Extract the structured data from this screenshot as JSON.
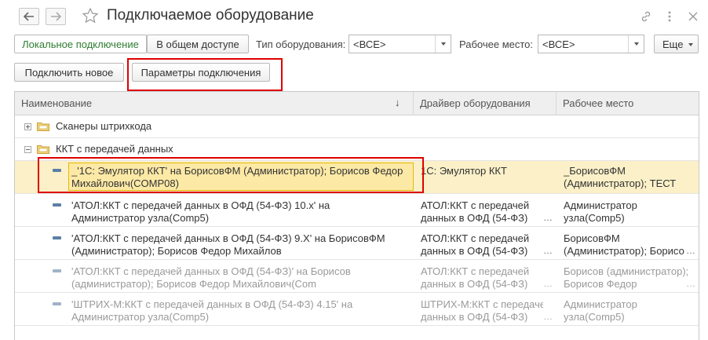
{
  "window": {
    "title": "Подключаемое оборудование"
  },
  "toolbar": {
    "local_tab": "Локальное подключение",
    "shared_tab": "В общем доступе",
    "equipment_type_label": "Тип оборудования:",
    "equipment_type_value": "<ВСЕ>",
    "workplace_label": "Рабочее место:",
    "workplace_value": "<ВСЕ>",
    "more_label": "Еще",
    "connect_new_label": "Подключить новое",
    "connection_params_label": "Параметры подключения"
  },
  "table": {
    "columns": [
      "Наименование",
      "Драйвер оборудования",
      "Рабочее место"
    ],
    "sort_indicator": "↓",
    "groups": [
      {
        "label": "Сканеры штрихкода",
        "expanded": false
      },
      {
        "label": "ККТ с передачей данных",
        "expanded": true
      }
    ],
    "rows": [
      {
        "name_line1": "_'1С: Эмулятор ККТ' на БорисовФМ (Администратор); Борисов Федор",
        "name_line2": "Михайлович(COMP08)",
        "driver_line1": "1С: Эмулятор ККТ",
        "driver_line2": "",
        "workplace_line1": "_БорисовФМ",
        "workplace_line2": "(Администратор); ТЕСТ",
        "selected": true,
        "dim": false
      },
      {
        "name_line1": "'АТОЛ:ККТ с передачей данных в ОФД (54-ФЗ) 10.x' на",
        "name_line2": "Администратор узла(Comp5)",
        "driver_line1": "АТОЛ:ККТ с передачей",
        "driver_line2": "данных в ОФД (54-ФЗ)",
        "workplace_line1": "Администратор",
        "workplace_line2": "узла(Comp5)",
        "selected": false,
        "dim": false
      },
      {
        "name_line1": "'АТОЛ:ККТ с передачей данных в ОФД (54-ФЗ) 9.X' на БорисовФМ",
        "name_line2": "(Администратор); Борисов Федор Михайлов",
        "driver_line1": "АТОЛ:ККТ с передачей",
        "driver_line2": "данных в ОФД (54-ФЗ)",
        "workplace_line1": "БорисовФМ",
        "workplace_line2": "(Администратор); Борисо",
        "selected": false,
        "dim": false
      },
      {
        "name_line1": "'АТОЛ:ККТ с передачей данных в ОФД (54-ФЗ)' на Борисов",
        "name_line2": "(администратор); Борисов Федор Михайлович(Com",
        "driver_line1": "АТОЛ:ККТ с передачей",
        "driver_line2": "данных в ОФД (54-ФЗ)",
        "workplace_line1": "Борисов (администратор);",
        "workplace_line2": "Борисов Федор",
        "selected": false,
        "dim": true
      },
      {
        "name_line1": "'ШТРИХ-М:ККТ с передачей данных в ОФД (54-ФЗ) 4.15' на",
        "name_line2": "Администратор узла(Comp5)",
        "driver_line1": "ШТРИХ-М:ККТ с передачей",
        "driver_line2": "данных в ОФД (54-ФЗ)",
        "workplace_line1": "Администратор",
        "workplace_line2": "узла(Comp5)",
        "selected": false,
        "dim": true
      }
    ]
  },
  "colors": {
    "active_tab_text": "#2e7d32",
    "selection_bg": "#fbf0c8",
    "selection_cell": "#fde9a6",
    "highlight_box": "#e00000"
  }
}
